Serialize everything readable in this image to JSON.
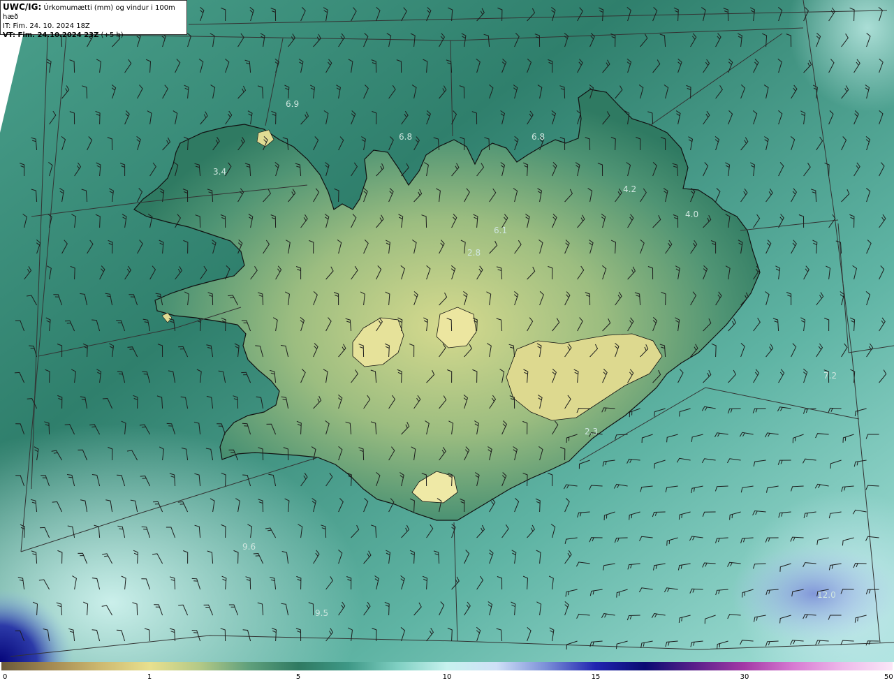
{
  "header": {
    "product": "UWC/IG:",
    "description": " Úrkomumætti (mm) og vindur i 100m hæð",
    "it_line": "IT: Fim. 24. 10. 2024 18Z",
    "vt_prefix": "VT: Fim. 24.10.2024 23Z",
    "vt_suffix": " (+5 h)"
  },
  "map": {
    "value_labels": [
      "6.9",
      "6.8",
      "6.8",
      "3.4",
      "4.2",
      "4.0",
      "6.1",
      "2.8",
      "7.2",
      "2.3",
      "9.6",
      "9.5",
      "12.0"
    ],
    "colors": {
      "ocean_deep": "#1f6e62",
      "ocean_mid": "#3e9886",
      "ocean_light": "#8ed8cc",
      "ocean_pale": "#c8f0ec",
      "land_low": "#2f7a62",
      "land_high": "#d9dc8f",
      "snow_patch": "#e6e29a",
      "deep_blue": "#07087a",
      "coast": "#111111",
      "grid": "#333333",
      "barb": "#222222"
    }
  },
  "colorbar": {
    "ticks": [
      "0",
      "1",
      "5",
      "10",
      "15",
      "30",
      "50"
    ],
    "gradient": [
      "#6b5a3a",
      "#a48a52",
      "#cdb970",
      "#e8e08e",
      "#b4c987",
      "#5fa07c",
      "#2f7a62",
      "#3e9886",
      "#7fcfc2",
      "#c7f2ee",
      "#cfe0f7",
      "#7b8fd8",
      "#2125b0",
      "#0a0b72",
      "#5a1f8a",
      "#a33aa6",
      "#d77ad2",
      "#efb8ea",
      "#fbe6f7"
    ]
  }
}
